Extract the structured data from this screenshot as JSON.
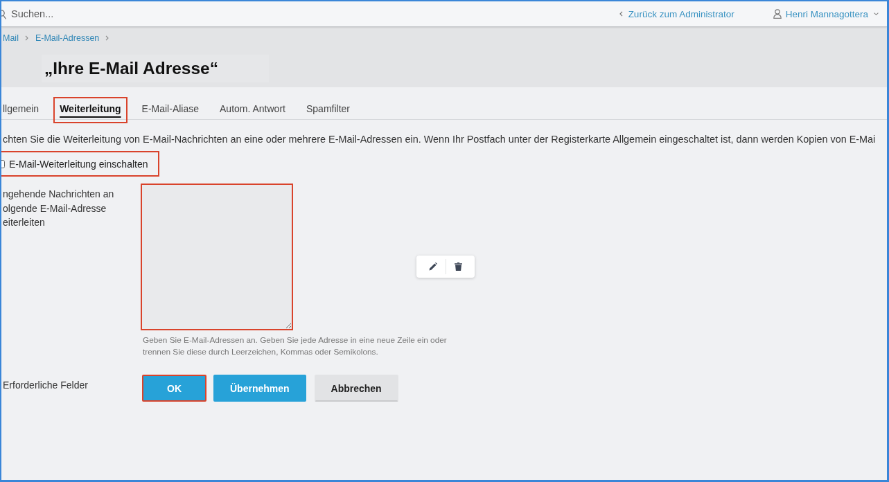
{
  "header": {
    "search": {
      "placeholder": "Suchen..."
    },
    "back_link": "Zurück zum Administrator",
    "user_menu": {
      "name": "Henri Mannagottera"
    }
  },
  "breadcrumbs": [
    "Mail",
    "E-Mail-Adressen"
  ],
  "title": "„Ihre E-Mail Adresse“",
  "tabs": [
    {
      "label": "llgemein",
      "selected": false,
      "highlighted": false
    },
    {
      "label": "Weiterleitung",
      "selected": true,
      "highlighted": true
    },
    {
      "label": "E-Mail-Aliase",
      "selected": false,
      "highlighted": false
    },
    {
      "label": "Autom. Antwort",
      "selected": false,
      "highlighted": false
    },
    {
      "label": "Spamfilter",
      "selected": false,
      "highlighted": false
    }
  ],
  "description": "chten Sie die Weiterleitung von E-Mail-Nachrichten an eine oder mehrere E-Mail-Adressen ein. Wenn Ihr Postfach unter der Registerkarte Allgemein eingeschaltet ist, dann werden Kopien von E-Mai",
  "forwarding_checkbox": {
    "label": "E-Mail-Weiterleitung einschalten",
    "checked": false,
    "highlighted": true
  },
  "forward_to": {
    "label_lines": [
      "ngehende Nachrichten an",
      "olgende E-Mail-Adresse",
      "eiterleiten"
    ],
    "highlighted": true,
    "hint": "Geben Sie E-Mail-Adressen an. Geben Sie jede Adresse in eine neue Zeile ein oder trennen Sie diese durch Leerzeichen, Kommas oder Semikolons."
  },
  "required_note": "Erforderliche Felder",
  "buttons": [
    {
      "label": "OK",
      "kind": "primary",
      "highlighted": true
    },
    {
      "label": "Übernehmen",
      "kind": "primary",
      "highlighted": false
    },
    {
      "label": "Abbrechen",
      "kind": "secondary",
      "highlighted": false
    }
  ]
}
